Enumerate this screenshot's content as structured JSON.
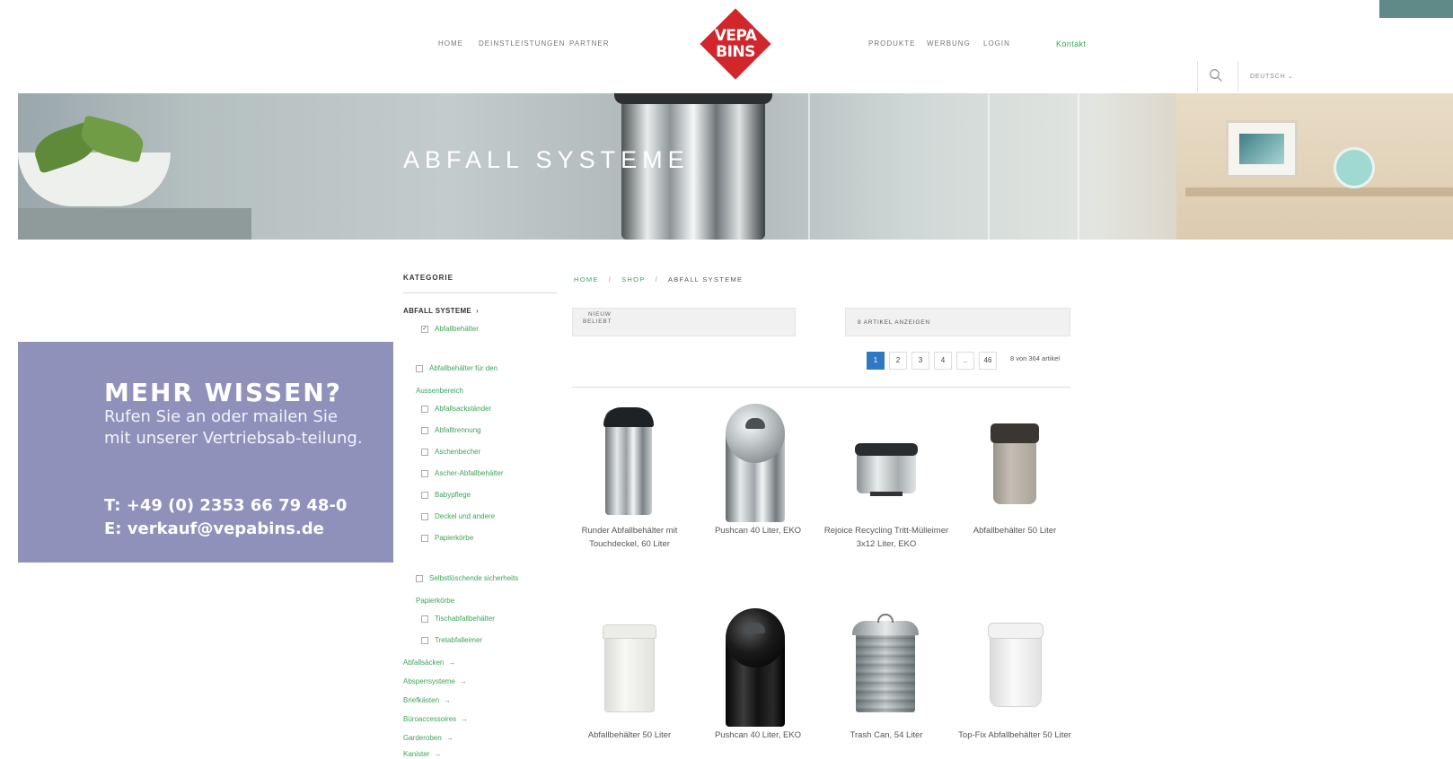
{
  "nav": {
    "left": [
      "HOME",
      "DEINSTLEISTUNGEN",
      "PARTNER"
    ],
    "right": [
      "PRODUKTE",
      "WERBUNG",
      "LOGIN"
    ],
    "kontakt": "Kontakt"
  },
  "logo": {
    "line1": "VEPA",
    "line2": "BINS",
    "color": "#d0262c"
  },
  "header": {
    "language": "DEUTSCH ⌄",
    "search_icon": "search-icon"
  },
  "hero": {
    "title": "ABFALL SYSTEME"
  },
  "info": {
    "title": "MEHR WISSEN?",
    "body": "Rufen Sie an oder mailen Sie mit unserer Vertriebsab-teilung.",
    "phone": "T: +49 (0) 2353 66 79 48-0",
    "email": "E: verkauf@vepabins.de",
    "bg_color": "#8f91bb"
  },
  "sidebar": {
    "title": "KATEGORIE",
    "main_category": "ABFALL SYSTEME",
    "items": [
      "Abfallbehälter",
      "Abfallbehälter für den",
      "Aussenbereich",
      "Abfallsackständer",
      "Abfalltrennung",
      "Aschenbecher",
      "Ascher-Abfallbehälter",
      "Babypflege",
      "Deckel und andere",
      "Papierkörbe",
      "Selbstlöschende sicherheits",
      "Papierkörbe",
      "Tischabfallbehälter",
      "Tretabfalleimer"
    ],
    "more": [
      "Abfallsäcken",
      "Absperrsysteme",
      "Briefkästen",
      "Büroaccessoires",
      "Garderoben",
      "Kanister"
    ]
  },
  "breadcrumb": {
    "home": "HOME",
    "shop": "SHOP",
    "sep": "/",
    "current": "ABFALL SYSTEME"
  },
  "sort": {
    "line1": "NIEUW",
    "line2": "BELIEBT"
  },
  "per_page": "8 ARTIKEL ANZEIGEN",
  "pagination": {
    "pages": [
      "1",
      "2",
      "3",
      "4",
      "..",
      "46"
    ],
    "active": "1",
    "count": "8 von 364 artikel"
  },
  "products": [
    {
      "name": "Runder Abfallbehälter mit Touchdeckel, 60 Liter",
      "icon": "stainless-bin-black-lid-icon"
    },
    {
      "name": "Pushcan 40 Liter, EKO",
      "icon": "chrome-pushcan-icon"
    },
    {
      "name": "Rejoice Recycling Tritt-Mülleimer 3x12 Liter, EKO",
      "icon": "recycling-pedal-bin-icon"
    },
    {
      "name": "Abfallbehälter 50 Liter",
      "icon": "taupe-swing-bin-icon"
    },
    {
      "name": "Abfallbehälter 50 Liter",
      "icon": "white-swing-bin-icon"
    },
    {
      "name": "Pushcan 40 Liter, EKO",
      "icon": "black-pushcan-icon"
    },
    {
      "name": "Trash Can, 54 Liter",
      "icon": "galvanized-trash-can-icon"
    },
    {
      "name": "Top-Fix Abfallbehälter 50 Liter",
      "icon": "white-topfix-bin-icon"
    }
  ]
}
